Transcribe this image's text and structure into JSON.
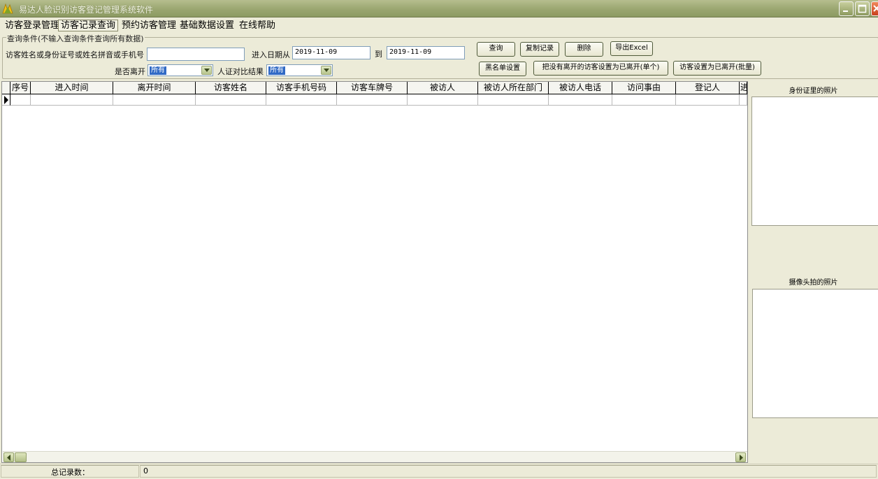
{
  "window": {
    "title": "易达人脸识别访客登记管理系统软件",
    "accent_color": "#9aa670"
  },
  "menu": {
    "items": [
      {
        "label": "访客登录管理"
      },
      {
        "label": "访客记录查询"
      },
      {
        "label": "预约访客管理"
      },
      {
        "label": "基础数据设置"
      },
      {
        "label": "在线帮助"
      }
    ],
    "active_index": 1
  },
  "query": {
    "legend": "查询条件(不输入查询条件查询所有数据)",
    "keyword_label": "访客姓名或身份证号或姓名拼音或手机号",
    "keyword_value": "",
    "date_from_label": "进入日期从",
    "date_from": "2019-11-09",
    "date_to_label": "到",
    "date_to": "2019-11-09",
    "left_label": "是否离开",
    "left_value": "所有",
    "match_label": "人证对比结果",
    "match_value": "所有"
  },
  "buttons": {
    "query": "查询",
    "copy": "复制记录",
    "delete": "删除",
    "export": "导出Excel",
    "blacklist": "黑名单设置",
    "set_left_single": "把没有离开的访客设置为已离开(单个)",
    "set_left_batch": "访客设置为已离开(批量)"
  },
  "grid": {
    "columns": [
      "序号",
      "进入时间",
      "离开时间",
      "访客姓名",
      "访客手机号码",
      "访客车牌号",
      "被访人",
      "被访人所在部门",
      "被访人电话",
      "访问事由",
      "登记人",
      "进"
    ],
    "rows": []
  },
  "photos": {
    "id_card_caption": "身份证里的照片",
    "camera_caption": "摄像头拍的照片"
  },
  "status": {
    "total_label": "总记录数：",
    "total_value": "0"
  }
}
